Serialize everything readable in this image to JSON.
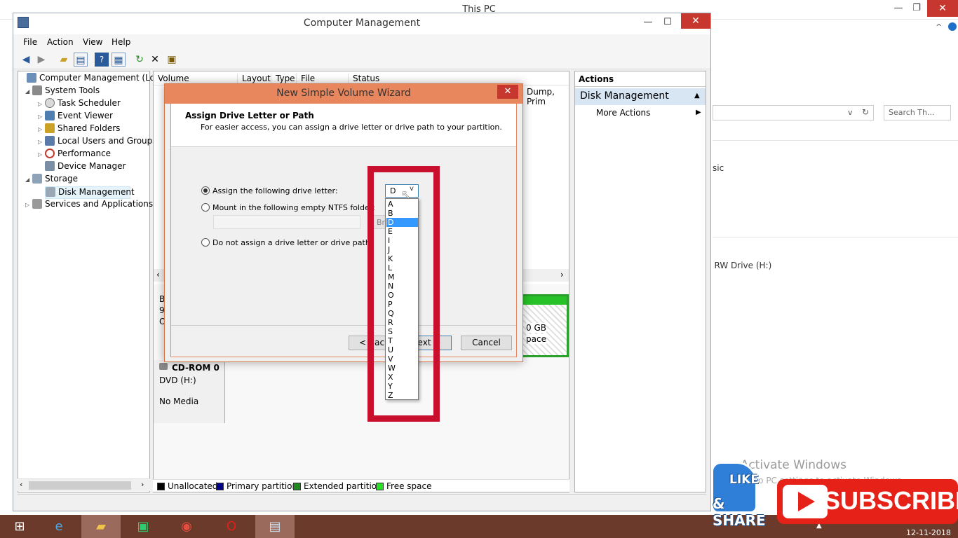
{
  "background_window": {
    "title": "This PC",
    "minimize": "—",
    "maximize": "❐",
    "close": "✕",
    "search_placeholder": "Search Th...",
    "detail_text_1": "sic",
    "detail_text_2": ") RW Drive (H:)"
  },
  "activation": {
    "title": "Activate Windows",
    "subtitle": "Go to PC settings to activate Windows."
  },
  "window": {
    "title": "Computer Management",
    "minimize": "—",
    "maximize": "☐",
    "close": "✕"
  },
  "menu": {
    "items": [
      "File",
      "Action",
      "View",
      "Help"
    ]
  },
  "toolbar": {
    "buttons": [
      "back-icon",
      "forward-icon",
      "up-folder-icon",
      "show-hide-tree-icon",
      "help-icon",
      "properties-icon",
      "refresh-icon",
      "delete-icon",
      "export-icon"
    ]
  },
  "tree": {
    "items": [
      {
        "label": "Computer Management (Local",
        "exp": "",
        "icon": "computer-icon"
      },
      {
        "label": "System Tools",
        "exp": "◢",
        "icon": "tools-icon"
      },
      {
        "label": "Task Scheduler",
        "exp": "▷",
        "icon": "clock-icon"
      },
      {
        "label": "Event Viewer",
        "exp": "▷",
        "icon": "event-viewer-icon"
      },
      {
        "label": "Shared Folders",
        "exp": "▷",
        "icon": "shared-folder-icon"
      },
      {
        "label": "Local Users and Groups",
        "exp": "▷",
        "icon": "users-icon"
      },
      {
        "label": "Performance",
        "exp": "▷",
        "icon": "performance-icon"
      },
      {
        "label": "Device Manager",
        "exp": "",
        "icon": "device-manager-icon"
      },
      {
        "label": "Storage",
        "exp": "◢",
        "icon": "storage-icon"
      },
      {
        "label": "Disk Management",
        "exp": "",
        "icon": "disk-icon"
      },
      {
        "label": "Services and Applications",
        "exp": "▷",
        "icon": "services-icon"
      }
    ]
  },
  "volume_table": {
    "columns": [
      "Volume",
      "Layout",
      "Type",
      "File System",
      "Status"
    ],
    "visible_status": "Dump, Prim"
  },
  "disk_map": {
    "cdrom_title": "CD-ROM 0",
    "cdrom_drive": "DVD (H:)",
    "cdrom_media": "No Media",
    "left_fragment_1": "B",
    "left_fragment_2": "9",
    "left_fragment_3": "O",
    "free_size": "0 GB",
    "free_label": "pace"
  },
  "legend": [
    {
      "label": "Unallocated",
      "color": "#000000"
    },
    {
      "label": "Primary partition",
      "color": "#00008b"
    },
    {
      "label": "Extended partition",
      "color": "#1f8a1f"
    },
    {
      "label": "Free space",
      "color": "#27e127"
    }
  ],
  "actions": {
    "header": "Actions",
    "section": "Disk Management",
    "more": "More Actions"
  },
  "wizard": {
    "title": "New Simple Volume Wizard",
    "close": "✕",
    "heading": "Assign Drive Letter or Path",
    "subheading": "For easier access, you can assign a drive letter or drive path to your partition.",
    "option_assign": "Assign the following drive letter:",
    "option_mount": "Mount in the following empty NTFS folder:",
    "option_none": "Do not assign a drive letter or drive path",
    "browse": "Br",
    "back": "< Back",
    "next": "Next >",
    "cancel": "Cancel"
  },
  "drive_letter": {
    "selected": "D",
    "options": [
      "A",
      "B",
      "D",
      "E",
      "I",
      "J",
      "K",
      "L",
      "M",
      "N",
      "O",
      "P",
      "Q",
      "R",
      "S",
      "T",
      "U",
      "V",
      "W",
      "X",
      "Y",
      "Z"
    ],
    "selected_index": 2
  },
  "taskbar": {
    "date": "12-11-2018"
  },
  "overlay": {
    "like": "LIKE",
    "share": "& SHARE",
    "subscribe": "SUBSCRIBE",
    "accent": "#e62117"
  }
}
